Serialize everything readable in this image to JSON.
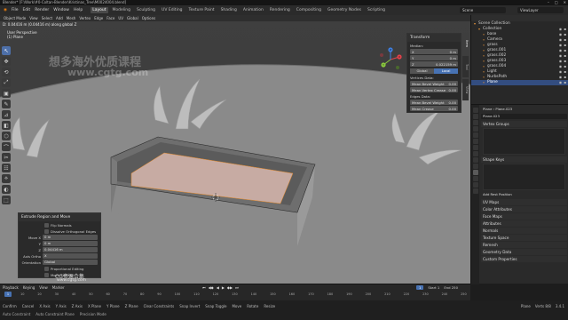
{
  "window": {
    "title": "Blender* [F:\\Work\\#0-Coltan-Blender\\Kristinas_Tree\\M0024004.blend]",
    "controls": [
      "–",
      "□",
      "✕"
    ]
  },
  "menus": [
    "File",
    "Edit",
    "Render",
    "Window",
    "Help"
  ],
  "workspace_tabs": [
    {
      "label": "Layout",
      "active": true
    },
    {
      "label": "Modeling",
      "active": false
    },
    {
      "label": "Sculpting",
      "active": false
    },
    {
      "label": "UV Editing",
      "active": false
    },
    {
      "label": "Texture Paint",
      "active": false
    },
    {
      "label": "Shading",
      "active": false
    },
    {
      "label": "Animation",
      "active": false
    },
    {
      "label": "Rendering",
      "active": false
    },
    {
      "label": "Compositing",
      "active": false
    },
    {
      "label": "Geometry Nodes",
      "active": false
    },
    {
      "label": "Scripting",
      "active": false
    }
  ],
  "scene": {
    "label": "Scene"
  },
  "view_layer": {
    "label": "ViewLayer"
  },
  "viewport": {
    "header_items": [
      "Object Mode",
      "View",
      "Select",
      "Add",
      "Mesh",
      "Vertex",
      "Edge",
      "Face",
      "UV",
      "Global",
      "Options"
    ],
    "status_text": "D: 0.04416 m (0.04416 m) along global Z",
    "perspective": "User Perspective",
    "object_label": "(1) Plane",
    "tool_icons": [
      "↖",
      "✥",
      "⟲",
      "⤢",
      "▣",
      "✎",
      "⊿",
      "◧",
      "⬡",
      "⌒",
      "✂",
      "☷",
      "⟡",
      "◐",
      "⬚"
    ],
    "gizmo_axes": [
      "X",
      "Y",
      "Z"
    ],
    "view_icons": [
      "🔍",
      "✋",
      "🎥",
      "▦"
    ]
  },
  "transform_panel": {
    "title": "Transform",
    "median_label": "Median:",
    "median": [
      {
        "axis": "X",
        "value": "0 m"
      },
      {
        "axis": "Y",
        "value": "0 m"
      },
      {
        "axis": "Z",
        "value": "0.022159 m"
      }
    ],
    "toggle": [
      {
        "label": "Global",
        "on": false
      },
      {
        "label": "Local",
        "on": true
      }
    ],
    "vertices_label": "Vertices Data:",
    "vertices": [
      {
        "label": "Mean Bevel Weight",
        "value": "0.00"
      },
      {
        "label": "Mean Vertex Crease",
        "value": "0.00"
      }
    ],
    "edges_label": "Edges Data:",
    "edges": [
      {
        "label": "Mean Bevel Weight",
        "value": "0.00"
      },
      {
        "label": "Mean Crease",
        "value": "0.00"
      }
    ],
    "side_tabs": [
      "Item",
      "Tool",
      "View"
    ]
  },
  "op_panel": {
    "title": "Extrude Region and Move",
    "checks": [
      "Flip Normals",
      "Dissolve Orthogonal Edges"
    ],
    "move": [
      {
        "label": "Move X",
        "value": "0 m"
      },
      {
        "label": "Y",
        "value": "0 m"
      },
      {
        "label": "Z",
        "value": "0.04416 m"
      }
    ],
    "axis_ortho": {
      "label": "Axis Ortho",
      "value": "X"
    },
    "orientation": {
      "label": "Orientation",
      "value": "Global"
    },
    "bottom_checks": [
      "Proportional Editing",
      "Move Editing"
    ]
  },
  "watermark": {
    "line1": "想多海外优质课程",
    "line2": "www.cgtg.com",
    "line3": "CG资源合集",
    "line4": "www.cgtg.com"
  },
  "outliner": {
    "title": "Scene Collection",
    "rows": [
      {
        "name": "Scene Collection",
        "icon": "▾",
        "sel": false,
        "indent": 0
      },
      {
        "name": "Collection",
        "icon": "▾",
        "sel": false,
        "indent": 1
      },
      {
        "name": "base",
        "icon": "▿",
        "sel": false,
        "indent": 2
      },
      {
        "name": "Camera",
        "icon": "▿",
        "sel": false,
        "indent": 2
      },
      {
        "name": "grass",
        "icon": "▿",
        "sel": false,
        "indent": 2
      },
      {
        "name": "grass.001",
        "icon": "▿",
        "sel": false,
        "indent": 2
      },
      {
        "name": "grass.002",
        "icon": "▿",
        "sel": false,
        "indent": 2
      },
      {
        "name": "grass.003",
        "icon": "▿",
        "sel": false,
        "indent": 2
      },
      {
        "name": "grass.004",
        "icon": "▿",
        "sel": false,
        "indent": 2
      },
      {
        "name": "Light",
        "icon": "▿",
        "sel": false,
        "indent": 2
      },
      {
        "name": "NurbsPath",
        "icon": "▿",
        "sel": false,
        "indent": 2
      },
      {
        "name": "Plane",
        "icon": "▿",
        "sel": true,
        "indent": 2
      }
    ]
  },
  "properties": {
    "object_name": "Plane",
    "mesh_name": "Plane.023",
    "mesh_field": "Plane.023",
    "sections": [
      "Vertex Groups",
      "Shape Keys",
      "UV Maps",
      "Color Attributes",
      "Face Maps",
      "Attributes",
      "Normals",
      "Texture Space",
      "Remesh",
      "Geometry Data",
      "Custom Properties"
    ],
    "add_rest": "Add Rest Position"
  },
  "timeline": {
    "header_items": [
      "Playback",
      "Keying",
      "View",
      "Marker"
    ],
    "controls": [
      "⏮",
      "◀◆",
      "◀",
      "▶",
      "◆▶",
      "⏭"
    ],
    "current_frame": "1",
    "start": {
      "label": "Start",
      "value": "1"
    },
    "end": {
      "label": "End",
      "value": "250"
    },
    "ruler": [
      "0",
      "10",
      "20",
      "30",
      "40",
      "50",
      "60",
      "70",
      "80",
      "90",
      "100",
      "110",
      "120",
      "130",
      "140",
      "150",
      "160",
      "170",
      "180",
      "190",
      "200",
      "210",
      "220",
      "230",
      "240",
      "250"
    ]
  },
  "statusbar": {
    "items": [
      "Confirm",
      "Cancel",
      "X Axis",
      "Y Axis",
      "Z Axis",
      "X Plane",
      "Y Plane",
      "Z Plane",
      "Clear Constraints",
      "Snap Invert",
      "Snap Toggle",
      "Move",
      "Rotate",
      "Resize",
      "Auto Constraint",
      "Auto Constraint Plane",
      "Precision Mode"
    ],
    "right": [
      "Plane",
      "Verts 8/8",
      "3.4.1"
    ]
  }
}
